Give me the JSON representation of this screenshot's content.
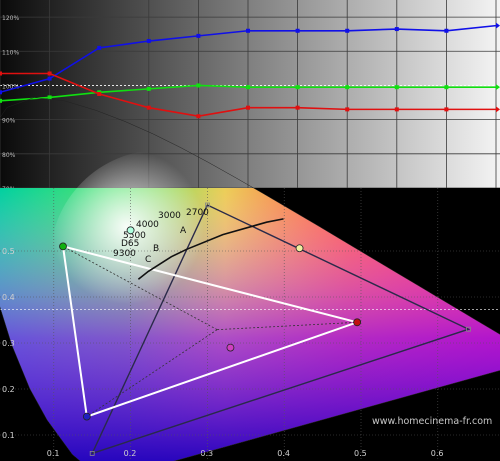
{
  "chart_data": [
    {
      "type": "line",
      "title": "",
      "xlabel": "",
      "ylabel": "",
      "y_tick_labels": [
        "120%",
        "110%",
        "100%",
        "90%",
        "80%",
        "70%"
      ],
      "ylim": [
        70,
        125
      ],
      "grid": true,
      "x": [
        0,
        1,
        2,
        3,
        4,
        5,
        6,
        7,
        8,
        9,
        10
      ],
      "series": [
        {
          "color": "#1010e8",
          "values": [
            98,
            102,
            111,
            113,
            114.5,
            116,
            116,
            116,
            116.5,
            116,
            117.5
          ]
        },
        {
          "color": "#10e010",
          "values": [
            95.5,
            96.5,
            98,
            99,
            100,
            99.5,
            99.5,
            99.5,
            99.5,
            99.5,
            99.5
          ]
        },
        {
          "color": "#e01010",
          "values": [
            103.5,
            103.5,
            97.5,
            93.5,
            91,
            93.5,
            93.5,
            93,
            93,
            93,
            93
          ]
        }
      ]
    },
    {
      "type": "scatter",
      "title": "",
      "xlabel": "",
      "ylabel": "",
      "xlim": [
        0.0,
        0.65
      ],
      "ylim": [
        0.0,
        0.6
      ],
      "x_tick_labels": [
        "0.1",
        "0.2",
        "0.3",
        "0.4",
        "0.5",
        "0.6"
      ],
      "y_tick_labels": [
        "0.1",
        "0.2",
        "0.3",
        "0.4",
        "0.5"
      ],
      "reference_gamut": [
        [
          0.64,
          0.33
        ],
        [
          0.3,
          0.6
        ],
        [
          0.15,
          0.06
        ]
      ],
      "measured_gamut": [
        [
          0.495,
          0.345
        ],
        [
          0.112,
          0.51
        ],
        [
          0.143,
          0.14
        ]
      ],
      "measured_primaries": [
        {
          "name": "red",
          "x": 0.495,
          "y": 0.345
        },
        {
          "name": "green",
          "x": 0.112,
          "y": 0.51
        },
        {
          "name": "blue",
          "x": 0.143,
          "y": 0.14
        }
      ],
      "measured_secondaries": [
        {
          "name": "yellow",
          "x": 0.42,
          "y": 0.506
        },
        {
          "name": "cyan",
          "x": 0.2,
          "y": 0.545
        },
        {
          "name": "magenta",
          "x": 0.33,
          "y": 0.29
        }
      ],
      "white_point": [
        0.3127,
        0.329
      ],
      "planckian_locus_labels": [
        "2700",
        "3000",
        "4000",
        "5500",
        "D65",
        "9300"
      ],
      "illuminant_labels": [
        "A",
        "B",
        "C"
      ],
      "watermark": "www.homecinema-fr.com"
    }
  ]
}
